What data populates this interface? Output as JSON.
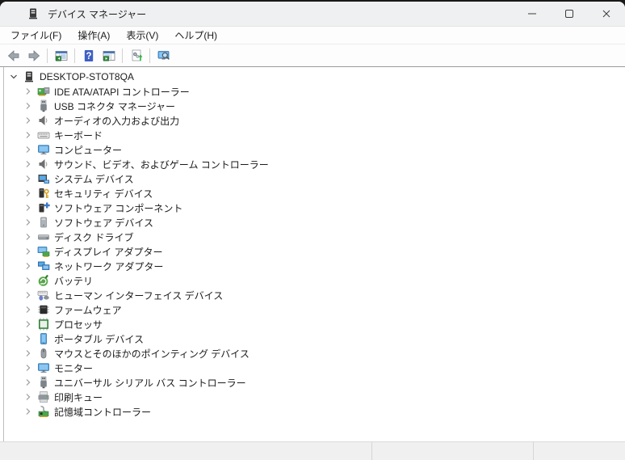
{
  "window": {
    "title": "デバイス マネージャー",
    "app_icon": "computer-tower-icon",
    "controls": [
      {
        "name": "minimize-button",
        "icon": "minimize-icon"
      },
      {
        "name": "maximize-button",
        "icon": "maximize-icon"
      },
      {
        "name": "close-button",
        "icon": "close-icon"
      }
    ]
  },
  "menu_bar": {
    "items": [
      {
        "label": "ファイル(F)"
      },
      {
        "label": "操作(A)"
      },
      {
        "label": "表示(V)"
      },
      {
        "label": "ヘルプ(H)"
      }
    ]
  },
  "toolbar": {
    "buttons": [
      {
        "type": "button",
        "name": "back-button",
        "icon": "back-icon"
      },
      {
        "type": "button",
        "name": "forward-button",
        "icon": "forward-icon"
      },
      {
        "type": "separator"
      },
      {
        "type": "button",
        "name": "console-tree-toggle-button",
        "icon": "console-tree-icon"
      },
      {
        "type": "separator"
      },
      {
        "type": "button",
        "name": "help-button",
        "icon": "help-icon"
      },
      {
        "type": "button",
        "name": "action-pane-toggle-button",
        "icon": "action-pane-icon"
      },
      {
        "type": "separator"
      },
      {
        "type": "button",
        "name": "scan-hardware-changes-button",
        "icon": "scan-hardware-icon"
      },
      {
        "type": "separator"
      },
      {
        "type": "button",
        "name": "computer-search-button",
        "icon": "computer-search-icon"
      }
    ]
  },
  "tree": {
    "root": {
      "label": "DESKTOP-STOT8QA",
      "icon": "computer-tower-icon",
      "expanded": true
    },
    "items": [
      {
        "label": "IDE ATA/ATAPI コントローラー",
        "icon": "ide-controller-icon"
      },
      {
        "label": "USB コネクタ マネージャー",
        "icon": "usb-icon"
      },
      {
        "label": "オーディオの入力および出力",
        "icon": "speaker-icon"
      },
      {
        "label": "キーボード",
        "icon": "keyboard-icon"
      },
      {
        "label": "コンピューター",
        "icon": "monitor-blue-icon"
      },
      {
        "label": "サウンド、ビデオ、およびゲーム コントローラー",
        "icon": "speaker-icon"
      },
      {
        "label": "システム デバイス",
        "icon": "system-devices-icon"
      },
      {
        "label": "セキュリティ デバイス",
        "icon": "security-key-icon"
      },
      {
        "label": "ソフトウェア コンポーネント",
        "icon": "software-components-icon"
      },
      {
        "label": "ソフトウェア デバイス",
        "icon": "software-devices-icon"
      },
      {
        "label": "ディスク ドライブ",
        "icon": "disk-drive-icon"
      },
      {
        "label": "ディスプレイ アダプター",
        "icon": "display-adapter-icon"
      },
      {
        "label": "ネットワーク アダプター",
        "icon": "network-adapter-icon"
      },
      {
        "label": "バッテリ",
        "icon": "battery-icon"
      },
      {
        "label": "ヒューマン インターフェイス デバイス",
        "icon": "hid-icon"
      },
      {
        "label": "ファームウェア",
        "icon": "firmware-chip-icon"
      },
      {
        "label": "プロセッサ",
        "icon": "processor-icon"
      },
      {
        "label": "ポータブル デバイス",
        "icon": "portable-device-icon"
      },
      {
        "label": "マウスとそのほかのポインティング デバイス",
        "icon": "mouse-icon"
      },
      {
        "label": "モニター",
        "icon": "monitor-blue-icon"
      },
      {
        "label": "ユニバーサル シリアル バス コントローラー",
        "icon": "usb-icon"
      },
      {
        "label": "印刷キュー",
        "icon": "printer-icon"
      },
      {
        "label": "記憶域コントローラー",
        "icon": "storage-controller-icon"
      }
    ]
  },
  "colors": {
    "titlebar_bg": "#eff0f1",
    "statusbar_bg": "#f0f0f0",
    "device_blue": "#5aa9e6",
    "board_green": "#4ca64c",
    "key_gold": "#d7a022",
    "toolbar_border": "#9b9b9b"
  }
}
